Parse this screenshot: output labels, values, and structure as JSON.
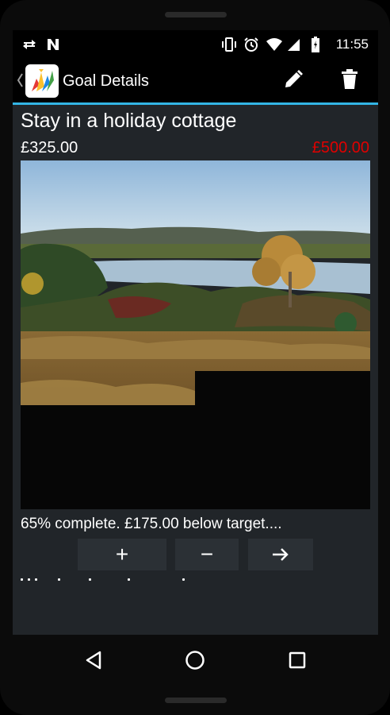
{
  "status_bar": {
    "time": "11:55",
    "icons": [
      "sync-icon",
      "n-icon",
      "vibrate-icon",
      "alarm-icon",
      "wifi-icon",
      "signal-icon",
      "battery-icon"
    ]
  },
  "action_bar": {
    "title": "Goal Details",
    "edit_icon": "pencil-icon",
    "delete_icon": "trash-icon"
  },
  "goal": {
    "title": "Stay in a holiday cottage",
    "saved_amount": "£325.00",
    "target_amount": "£500.00",
    "target_color": "#e00000",
    "progress_text": "65% complete. £175.00 below target....",
    "progress_percent": 65
  },
  "buttons": {
    "add": "+",
    "subtract": "−",
    "next_icon": "arrow-right-icon"
  },
  "nav_bar": {
    "back_icon": "back-triangle-icon",
    "home_icon": "home-circle-icon",
    "recents_icon": "recents-square-icon"
  },
  "colors": {
    "accent": "#33b5e5",
    "background": "#212529"
  }
}
